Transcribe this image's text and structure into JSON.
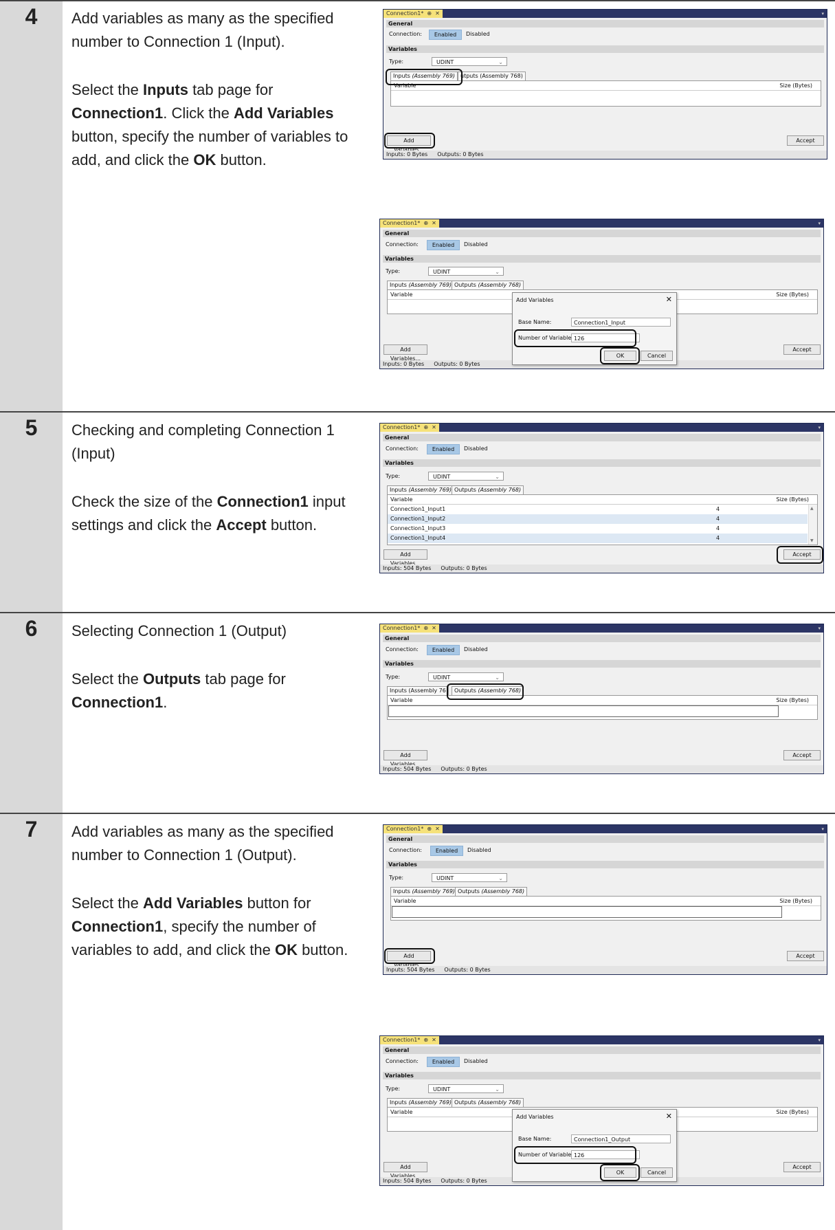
{
  "steps": [
    {
      "number": "4",
      "p1": "Add variables as many as the specified number to Connection 1 (Input).",
      "p2": {
        "t1": "Select the ",
        "b1": "Inputs",
        "t2": " tab page for ",
        "b2": "Connection1",
        "t3": ". Click the ",
        "b3": "Add Variables",
        "t4": " button, specify the number of variables to add, and click the ",
        "b4": "OK",
        "t5": " button."
      }
    },
    {
      "number": "5",
      "p1": "Checking and completing Connection 1 (Input)",
      "p2": {
        "t1": "Check the size of the ",
        "b1": "Connection1",
        "t2": " in­put settings and click the ",
        "b2": "Accept",
        "t3": " but­ton."
      }
    },
    {
      "number": "6",
      "p1": "Selecting Connection 1 (Output)",
      "p2": {
        "t1": "Select the ",
        "b1": "Outputs",
        "t2": " tab page for ",
        "b2": "Connection1",
        "t3": "."
      }
    },
    {
      "number": "7",
      "p1": "Add variables as many as the specified number to Connection 1 (Output).",
      "p2": {
        "t1": "Select the ",
        "b1": "Add Variables",
        "t2": " button for ",
        "b2": "Connection1",
        "t3": ", specify the number of variables to add, and click the ",
        "b3": "OK",
        "t4": " but­ton."
      }
    }
  ],
  "ui": {
    "tab_title": "Connection1*",
    "pin_icon": "⊕",
    "close_icon": "✕",
    "general": "General",
    "connection_label": "Connection:",
    "enabled": "Enabled",
    "disabled": "Disabled",
    "variables": "Variables",
    "type_label": "Type:",
    "type_value": "UDINT",
    "inputs_tab": "Inputs ",
    "inputs_tab_it": "(Assembly 769)",
    "inputs_tab_cut": "Inputs (Assembly 76",
    "outputs_tab": "Outputs ",
    "outputs_tab_it": "(Assembly 768)",
    "outputs_tab_cut": "utputs (Assembly 768)",
    "col_variable": "Variable",
    "col_size": "Size (Bytes)",
    "add_variables": "Add Variables...",
    "accept": "Accept",
    "status_in_0": "Inputs: 0 Bytes",
    "status_in_504": "Inputs: 504 Bytes",
    "status_out_0": "Outputs: 0 Bytes",
    "dialog_title": "Add Variables",
    "dialog_base_label": "Base Name:",
    "dialog_base_input": "Connection1_Input",
    "dialog_base_output": "Connection1_Output",
    "dialog_num_label": "Number of Variables:",
    "dialog_num_value": "126",
    "ok": "OK",
    "cancel": "Cancel",
    "rows": [
      {
        "name": "Connection1_Input1",
        "size": "4"
      },
      {
        "name": "Connection1_Input2",
        "size": "4"
      },
      {
        "name": "Connection1_Input3",
        "size": "4"
      },
      {
        "name": "Connection1_Input4",
        "size": "4"
      }
    ]
  }
}
